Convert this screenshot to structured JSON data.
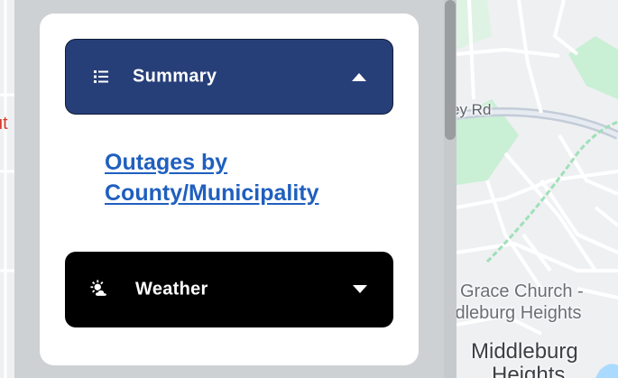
{
  "map": {
    "road_label": "ey Rd",
    "place_label_line1": "Grace Church -",
    "place_label_line2": "ldleburg Heights",
    "town_label_line1": "Middleburg",
    "town_label_line2": "Heights",
    "left_label": "ut"
  },
  "panel": {
    "summary": {
      "title": "Summary",
      "icon": "list-icon",
      "state": "expanded",
      "link_label": "Outages by County/Municipality"
    },
    "weather": {
      "title": "Weather",
      "icon": "partly-cloudy-icon",
      "state": "collapsed"
    }
  },
  "colors": {
    "summary_header_bg": "#273f79",
    "weather_header_bg": "#000000",
    "link": "#1f5fbf",
    "panel_frame": "#ced1d4",
    "map_park": "#c9efd5"
  }
}
